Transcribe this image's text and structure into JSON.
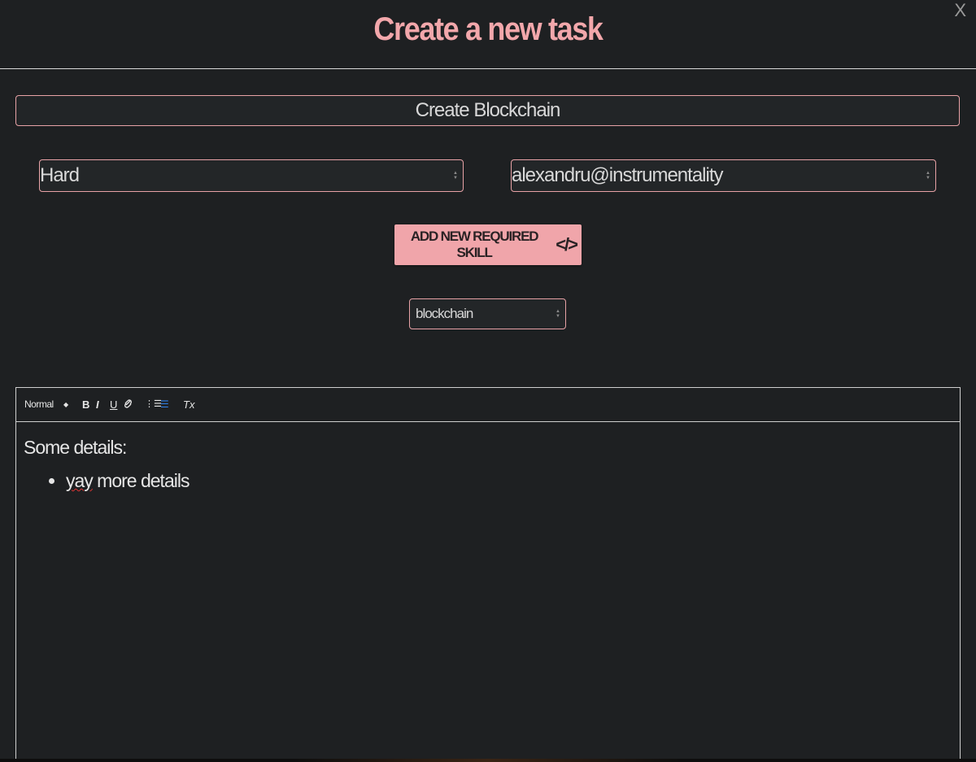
{
  "modal": {
    "title": "Create a new task",
    "close_label": "X"
  },
  "form": {
    "task_name": "Create Blockchain",
    "difficulty": "Hard",
    "assignee": "alexandru@instrumentality",
    "add_skill_label": "ADD NEW REQUIRED SKILL",
    "add_skill_icon": "</>",
    "skill": "blockchain"
  },
  "editor": {
    "toolbar": {
      "format": "Normal",
      "bold": "B",
      "italic": "I",
      "underline": "U",
      "link": "🔗",
      "ordered_list": "⋮☰",
      "bullet_list": "☰",
      "clean": "Tx"
    },
    "content": {
      "paragraph": "Some details:",
      "bullet_prefix": "yay",
      "bullet_rest": " more details"
    }
  },
  "colors": {
    "accent": "#f0a5aa",
    "background": "#1e2022",
    "active_tool": "#2f7de1"
  },
  "icons": [
    "close-icon",
    "code-icon",
    "select-arrows-icon",
    "link-icon"
  ]
}
